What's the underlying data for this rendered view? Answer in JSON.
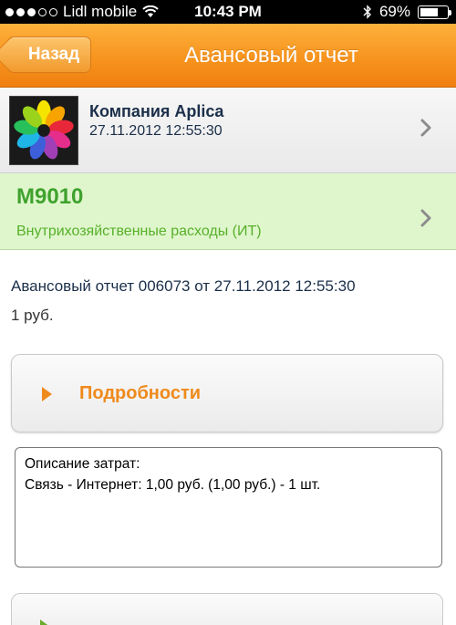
{
  "status_bar": {
    "carrier": "Lidl mobile",
    "time": "10:43 PM",
    "battery": "69%",
    "battery_level": 0.69,
    "signal_bars_filled": 3,
    "signal_bars_total": 5
  },
  "nav": {
    "back_label": "Назад",
    "title": "Авансовый отчет"
  },
  "company": {
    "name": "Компания Aplica",
    "datetime": "27.11.2012 12:55:30"
  },
  "code": {
    "value": "M9010",
    "description": "Внутрихозяйственные расходы (ИТ)"
  },
  "report": {
    "line": "Авансовый отчет 006073 от 27.11.2012 12:55:30",
    "amount": "1 руб."
  },
  "details_button": {
    "label": "Подробности"
  },
  "expense": {
    "heading": "Описание затрат:",
    "line": "Связь - Интернет: 1,00 руб. (1,00 руб.) - 1 шт."
  },
  "colors": {
    "nav_orange": "#f7941e",
    "accent_orange": "#ef8a1c",
    "green_text": "#3fa22e",
    "green_bg": "#dff6cc",
    "navy_text": "#1b2f4a"
  }
}
